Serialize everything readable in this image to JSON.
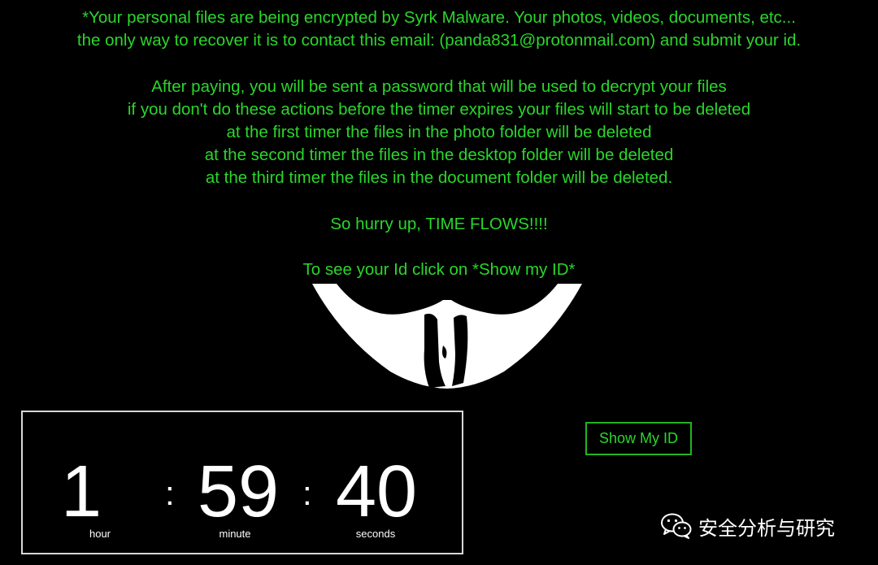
{
  "ransom_note": {
    "line1": "*Your personal files are being encrypted by Syrk Malware. Your photos, videos, documents, etc...",
    "line2": "the only way to recover it is to contact this email: (panda831@protonmail.com) and submit your id.",
    "line3": "After paying, you will be sent a password that will be used to decrypt your files",
    "line4": "if you don't do these actions before the timer expires your files will start to be deleted",
    "line5": "at the first timer the files in the photo folder will be deleted",
    "line6": "at the second timer the files in the desktop folder will be deleted",
    "line7": "at the third timer the files in the document folder will be deleted.",
    "line8": "So hurry up, TIME FLOWS!!!!",
    "line9": "To see your Id click on *Show my ID*"
  },
  "timer": {
    "hours": "1",
    "minutes": "59",
    "seconds": "40",
    "separator": ":",
    "hour_label": "hour",
    "minute_label": "minute",
    "seconds_label": "seconds"
  },
  "show_id_button": {
    "label": "Show My ID"
  },
  "watermark": {
    "text": "安全分析与研究",
    "icon": "wechat-icon"
  },
  "colors": {
    "background": "#000000",
    "note_text": "#2bd62b",
    "timer_text": "#ffffff",
    "button_border": "#22b322"
  }
}
